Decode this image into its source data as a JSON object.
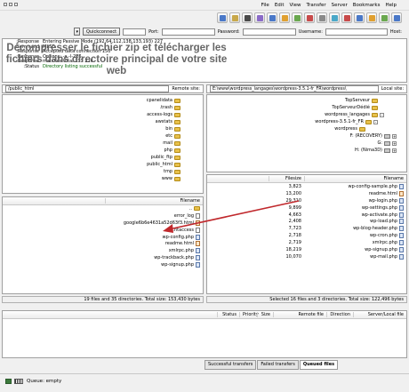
{
  "menu": [
    "Help",
    "Bookmarks",
    "Server",
    "Transfer",
    "View",
    "Edit",
    "File"
  ],
  "quickconnect": {
    "host_label": "Host:",
    "username_label": "Username:",
    "password_label": "Password:",
    "port_label": "Port:",
    "button_label": "Quickconnect"
  },
  "message_log": [
    {
      "key": "Response:",
      "text": "227 Entering Passive Mode (192,64,112,138,133,193)",
      "ok": false
    },
    {
      "key": "Command:",
      "text": "MLSD",
      "ok": false
    },
    {
      "key": "Response:",
      "text": "150 Accepted data connection",
      "ok": false
    },
    {
      "key": "Response:",
      "text": "226-Options: -a -l",
      "ok": false
    },
    {
      "key": "Response:",
      "text": "226 133 matches total",
      "ok": false
    },
    {
      "key": "Status:",
      "text": "Directory listing successful",
      "ok": true
    },
    {
      "key": "",
      "text": "",
      "ok": false
    }
  ],
  "caption": "Décompresser le fichier zip et télécharger les fichiers dans directoire principal de votre site web",
  "local": {
    "site_label": "Local site:",
    "path": "E:\\www\\wordpress_langages\\wordpress-3.5.1-fr_FR\\wordpress\\",
    "tree": [
      {
        "label": "TopServeur",
        "type": "folder",
        "indent": 3,
        "exp": ""
      },
      {
        "label": "TopServeurDédié",
        "type": "folder",
        "indent": 3,
        "exp": ""
      },
      {
        "label": "wordpress_langages",
        "type": "folder",
        "indent": 3,
        "exp": "-"
      },
      {
        "label": "wordpress-3.5.1-fr_FR",
        "type": "folder",
        "indent": 4,
        "exp": "-"
      },
      {
        "label": "wordpress",
        "type": "folder",
        "indent": 5,
        "exp": ""
      },
      {
        "label": "F: (RECOVERY)",
        "type": "drive",
        "indent": 1,
        "exp": "+"
      },
      {
        "label": "G:",
        "type": "drive",
        "indent": 1,
        "exp": "+"
      },
      {
        "label": "H: (Nima3D)",
        "type": "drive",
        "indent": 1,
        "exp": "+"
      }
    ],
    "columns": [
      "Filename",
      "Filesize"
    ],
    "files": [
      {
        "name": "wp-config-sample.php",
        "size": "3,823",
        "kind": "php"
      },
      {
        "name": "readme.html",
        "size": "13,200",
        "kind": "html"
      },
      {
        "name": "wp-login.php",
        "size": "29,310",
        "kind": "php"
      },
      {
        "name": "wp-settings.php",
        "size": "9,899",
        "kind": "php"
      },
      {
        "name": "wp-activate.php",
        "size": "4,663",
        "kind": "php"
      },
      {
        "name": "wp-load.php",
        "size": "2,408",
        "kind": "php"
      },
      {
        "name": "wp-blog-header.php",
        "size": "7,723",
        "kind": "php"
      },
      {
        "name": "wp-cron.php",
        "size": "2,718",
        "kind": "php"
      },
      {
        "name": "xmlrpc.php",
        "size": "2,719",
        "kind": "php"
      },
      {
        "name": "wp-signup.php",
        "size": "18,219",
        "kind": "php"
      },
      {
        "name": "wp-mail.php",
        "size": "10,070",
        "kind": "php"
      }
    ],
    "status": "Selected 16 files and 3 directories. Total size: 122,496 bytes"
  },
  "remote": {
    "site_label": "Remote site:",
    "path": "/public_html",
    "tree": [
      {
        "label": "cpanelidata",
        "type": "folder",
        "indent": 2,
        "exp": ""
      },
      {
        "label": ".trash",
        "type": "folder",
        "indent": 2,
        "exp": ""
      },
      {
        "label": "access-logs",
        "type": "folder",
        "indent": 2,
        "exp": ""
      },
      {
        "label": "awstats",
        "type": "folder",
        "indent": 2,
        "exp": ""
      },
      {
        "label": "bin",
        "type": "folder",
        "indent": 2,
        "exp": ""
      },
      {
        "label": "etc",
        "type": "folder",
        "indent": 2,
        "exp": ""
      },
      {
        "label": "mail",
        "type": "folder",
        "indent": 2,
        "exp": ""
      },
      {
        "label": "php",
        "type": "folder",
        "indent": 2,
        "exp": ""
      },
      {
        "label": "public_ftp",
        "type": "folder",
        "indent": 2,
        "exp": ""
      },
      {
        "label": "public_html",
        "type": "folder",
        "indent": 2,
        "exp": ""
      },
      {
        "label": "tmp",
        "type": "folder",
        "indent": 2,
        "exp": ""
      },
      {
        "label": "www",
        "type": "folder",
        "indent": 2,
        "exp": ""
      }
    ],
    "columns": [
      "Filename"
    ],
    "files": [
      {
        "name": "..",
        "kind": "folder"
      },
      {
        "name": "error_log",
        "kind": "file"
      },
      {
        "name": "google6b6e4631a52d63f3.html",
        "kind": "html"
      },
      {
        "name": ".htaccess",
        "kind": "file"
      },
      {
        "name": "wp-config.php",
        "kind": "php"
      },
      {
        "name": "readme.html",
        "kind": "html"
      },
      {
        "name": "xmlrpc.php",
        "kind": "php"
      },
      {
        "name": "wp-trackback.php",
        "kind": "php"
      },
      {
        "name": "wp-signup.php",
        "kind": "php"
      }
    ],
    "status": "19 files and 35 directories. Total size: 153,430 bytes"
  },
  "queue_columns": [
    "Server/Local file",
    "Direction",
    "Remote file",
    "Size",
    "Priority",
    "Status"
  ],
  "queue_tabs": [
    "Queued files",
    "Failed transfers",
    "Successful transfers"
  ],
  "bottom_status": "Queue: empty",
  "colors": {
    "arrow": "#c0282c",
    "caption": "#666666",
    "ok_text": "#006400"
  }
}
